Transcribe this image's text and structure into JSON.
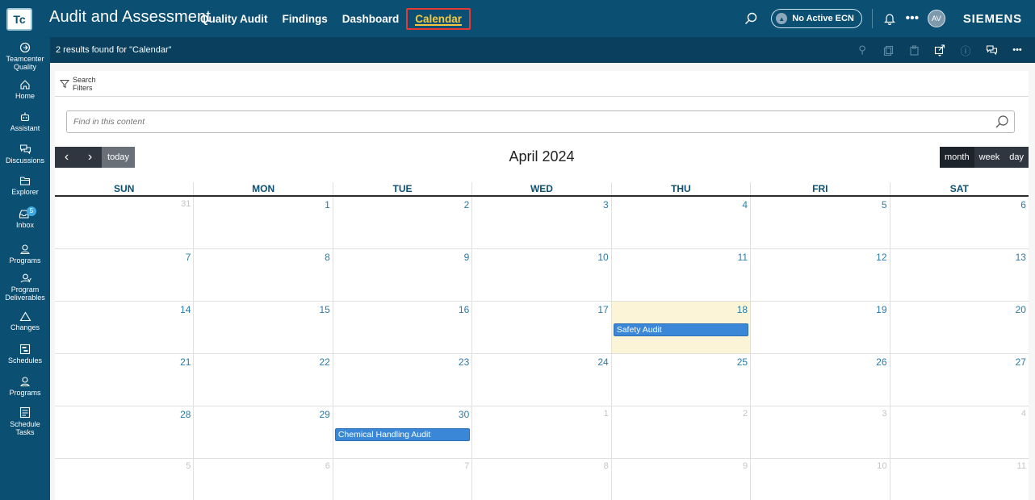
{
  "header": {
    "logo": "Tc",
    "app_title": "Audit and Assessment",
    "nav": [
      {
        "label": "Quality Audit"
      },
      {
        "label": "Findings"
      },
      {
        "label": "Dashboard"
      },
      {
        "label": "Calendar",
        "active": true
      }
    ],
    "ecn_label": "No Active ECN",
    "avatar_initials": "AV",
    "brand": "SIEMENS"
  },
  "rail": {
    "items": [
      {
        "label": "Teamcenter Quality",
        "icon": "teamcenter-icon"
      },
      {
        "label": "Home",
        "icon": "home-icon"
      },
      {
        "label": "Assistant",
        "icon": "assistant-icon"
      },
      {
        "label": "Discussions",
        "icon": "discussions-icon"
      },
      {
        "label": "Explorer",
        "icon": "folder-icon"
      },
      {
        "label": "Inbox",
        "icon": "inbox-icon",
        "badge": "5"
      },
      {
        "label": "Programs",
        "icon": "programs-icon"
      },
      {
        "label": "Program Deliverables",
        "icon": "deliverables-icon"
      },
      {
        "label": "Changes",
        "icon": "changes-icon"
      },
      {
        "label": "Schedules",
        "icon": "schedules-icon"
      },
      {
        "label": "Programs",
        "icon": "programs-icon"
      },
      {
        "label": "Schedule Tasks",
        "icon": "schedule-tasks-icon"
      }
    ]
  },
  "results": {
    "text": "2 results found for \"Calendar\""
  },
  "filters": {
    "line1": "Search",
    "line2": "Filters"
  },
  "find": {
    "placeholder": "Find in this content"
  },
  "calendar": {
    "today_label": "today",
    "title": "April 2024",
    "views": [
      "month",
      "week",
      "day"
    ],
    "active_view": "month",
    "weekdays": [
      "SUN",
      "MON",
      "TUE",
      "WED",
      "THU",
      "FRI",
      "SAT"
    ],
    "weeks": [
      [
        {
          "d": "31",
          "other": true
        },
        {
          "d": "1"
        },
        {
          "d": "2"
        },
        {
          "d": "3"
        },
        {
          "d": "4"
        },
        {
          "d": "5"
        },
        {
          "d": "6"
        }
      ],
      [
        {
          "d": "7"
        },
        {
          "d": "8"
        },
        {
          "d": "9"
        },
        {
          "d": "10"
        },
        {
          "d": "11"
        },
        {
          "d": "12"
        },
        {
          "d": "13"
        }
      ],
      [
        {
          "d": "14"
        },
        {
          "d": "15"
        },
        {
          "d": "16"
        },
        {
          "d": "17"
        },
        {
          "d": "18",
          "today": true,
          "event": "Safety Audit"
        },
        {
          "d": "19"
        },
        {
          "d": "20"
        }
      ],
      [
        {
          "d": "21"
        },
        {
          "d": "22"
        },
        {
          "d": "23"
        },
        {
          "d": "24"
        },
        {
          "d": "25"
        },
        {
          "d": "26"
        },
        {
          "d": "27"
        }
      ],
      [
        {
          "d": "28"
        },
        {
          "d": "29"
        },
        {
          "d": "30",
          "event": "Chemical Handling Audit"
        },
        {
          "d": "1",
          "other": true
        },
        {
          "d": "2",
          "other": true
        },
        {
          "d": "3",
          "other": true
        },
        {
          "d": "4",
          "other": true
        }
      ],
      [
        {
          "d": "5",
          "other": true
        },
        {
          "d": "6",
          "other": true
        },
        {
          "d": "7",
          "other": true
        },
        {
          "d": "8",
          "other": true
        },
        {
          "d": "9",
          "other": true
        },
        {
          "d": "10",
          "other": true
        },
        {
          "d": "11",
          "other": true
        }
      ]
    ]
  },
  "colors": {
    "header_bg": "#0b4f73",
    "results_bg": "#0a3f5d",
    "active_nav": "#f5c842",
    "event_bg": "#3a87d8",
    "today_bg": "#fcf4d6"
  }
}
